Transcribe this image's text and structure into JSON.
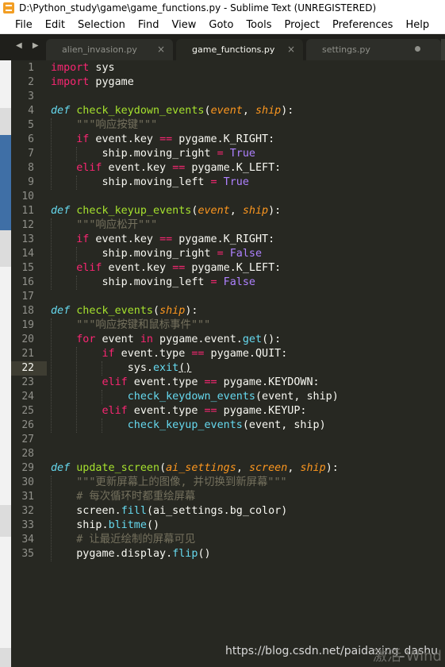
{
  "window": {
    "title": "D:\\Python_study\\game\\game_functions.py - Sublime Text (UNREGISTERED)"
  },
  "menu": [
    "File",
    "Edit",
    "Selection",
    "Find",
    "View",
    "Goto",
    "Tools",
    "Project",
    "Preferences",
    "Help"
  ],
  "tabs": [
    {
      "label": "alien_invasion.py",
      "state": "close"
    },
    {
      "label": "game_functions.py",
      "state": "active"
    },
    {
      "label": "settings.py",
      "state": "modified"
    }
  ],
  "nav_arrows": "◀ ▶",
  "close_glyph": "×",
  "editor": {
    "current_line": 22
  },
  "lines": [
    [
      [
        "k",
        "import"
      ],
      [
        "t",
        " sys"
      ]
    ],
    [
      [
        "k",
        "import"
      ],
      [
        "t",
        " pygame"
      ]
    ],
    [],
    [
      [
        "d",
        "def"
      ],
      [
        "t",
        " "
      ],
      [
        "f",
        "check_keydown_events"
      ],
      [
        "t",
        "("
      ],
      [
        "p",
        "event"
      ],
      [
        "t",
        ", "
      ],
      [
        "p",
        "ship"
      ],
      [
        "t",
        "):"
      ]
    ],
    [
      [
        "t",
        "    "
      ],
      [
        "c",
        "\"\"\"响应按键\"\"\""
      ]
    ],
    [
      [
        "t",
        "    "
      ],
      [
        "k",
        "if"
      ],
      [
        "t",
        " event.key "
      ],
      [
        "k",
        "=="
      ],
      [
        "t",
        " pygame.K_RIGHT:"
      ]
    ],
    [
      [
        "t",
        "        ship.moving_right "
      ],
      [
        "k",
        "="
      ],
      [
        "t",
        " "
      ],
      [
        "n",
        "True"
      ]
    ],
    [
      [
        "t",
        "    "
      ],
      [
        "k",
        "elif"
      ],
      [
        "t",
        " event.key "
      ],
      [
        "k",
        "=="
      ],
      [
        "t",
        " pygame.K_LEFT:"
      ]
    ],
    [
      [
        "t",
        "        ship.moving_left "
      ],
      [
        "k",
        "="
      ],
      [
        "t",
        " "
      ],
      [
        "n",
        "True"
      ]
    ],
    [],
    [
      [
        "d",
        "def"
      ],
      [
        "t",
        " "
      ],
      [
        "f",
        "check_keyup_events"
      ],
      [
        "t",
        "("
      ],
      [
        "p",
        "event"
      ],
      [
        "t",
        ", "
      ],
      [
        "p",
        "ship"
      ],
      [
        "t",
        "):"
      ]
    ],
    [
      [
        "t",
        "    "
      ],
      [
        "c",
        "\"\"\"响应松开\"\"\""
      ]
    ],
    [
      [
        "t",
        "    "
      ],
      [
        "k",
        "if"
      ],
      [
        "t",
        " event.key "
      ],
      [
        "k",
        "=="
      ],
      [
        "t",
        " pygame.K_RIGHT:"
      ]
    ],
    [
      [
        "t",
        "        ship.moving_right "
      ],
      [
        "k",
        "="
      ],
      [
        "t",
        " "
      ],
      [
        "n",
        "False"
      ]
    ],
    [
      [
        "t",
        "    "
      ],
      [
        "k",
        "elif"
      ],
      [
        "t",
        " event.key "
      ],
      [
        "k",
        "=="
      ],
      [
        "t",
        " pygame.K_LEFT:"
      ]
    ],
    [
      [
        "t",
        "        ship.moving_left "
      ],
      [
        "k",
        "="
      ],
      [
        "t",
        " "
      ],
      [
        "n",
        "False"
      ]
    ],
    [],
    [
      [
        "d",
        "def"
      ],
      [
        "t",
        " "
      ],
      [
        "f",
        "check_events"
      ],
      [
        "t",
        "("
      ],
      [
        "p",
        "ship"
      ],
      [
        "t",
        "):"
      ]
    ],
    [
      [
        "t",
        "    "
      ],
      [
        "c",
        "\"\"\"响应按键和鼠标事件\"\"\""
      ]
    ],
    [
      [
        "t",
        "    "
      ],
      [
        "k",
        "for"
      ],
      [
        "t",
        " event "
      ],
      [
        "k",
        "in"
      ],
      [
        "t",
        " pygame.event."
      ],
      [
        "b",
        "get"
      ],
      [
        "t",
        "():"
      ]
    ],
    [
      [
        "t",
        "        "
      ],
      [
        "k",
        "if"
      ],
      [
        "t",
        " event.type "
      ],
      [
        "k",
        "=="
      ],
      [
        "t",
        " pygame.QUIT:"
      ]
    ],
    [
      [
        "t",
        "            sys."
      ],
      [
        "b",
        "exit"
      ],
      [
        "u",
        "()"
      ]
    ],
    [
      [
        "t",
        "        "
      ],
      [
        "k",
        "elif"
      ],
      [
        "t",
        " event.type "
      ],
      [
        "k",
        "=="
      ],
      [
        "t",
        " pygame.KEYDOWN:"
      ]
    ],
    [
      [
        "t",
        "            "
      ],
      [
        "b",
        "check_keydown_events"
      ],
      [
        "t",
        "(event, ship)"
      ]
    ],
    [
      [
        "t",
        "        "
      ],
      [
        "k",
        "elif"
      ],
      [
        "t",
        " event.type "
      ],
      [
        "k",
        "=="
      ],
      [
        "t",
        " pygame.KEYUP:"
      ]
    ],
    [
      [
        "t",
        "            "
      ],
      [
        "b",
        "check_keyup_events"
      ],
      [
        "t",
        "(event, ship)"
      ]
    ],
    [],
    [],
    [
      [
        "d",
        "def"
      ],
      [
        "t",
        " "
      ],
      [
        "f",
        "update_screen"
      ],
      [
        "t",
        "("
      ],
      [
        "p",
        "ai_settings"
      ],
      [
        "t",
        ", "
      ],
      [
        "p",
        "screen"
      ],
      [
        "t",
        ", "
      ],
      [
        "p",
        "ship"
      ],
      [
        "t",
        "):"
      ]
    ],
    [
      [
        "t",
        "    "
      ],
      [
        "c",
        "\"\"\"更新屏幕上的图像, 并切换到新屏幕\"\"\""
      ]
    ],
    [
      [
        "t",
        "    "
      ],
      [
        "c",
        "# 每次循环时都重绘屏幕"
      ]
    ],
    [
      [
        "t",
        "    screen."
      ],
      [
        "b",
        "fill"
      ],
      [
        "t",
        "(ai_settings.bg_color)"
      ]
    ],
    [
      [
        "t",
        "    ship."
      ],
      [
        "b",
        "blitme"
      ],
      [
        "t",
        "()"
      ]
    ],
    [
      [
        "t",
        "    "
      ],
      [
        "c",
        "# 让最近绘制的屏幕可见"
      ]
    ],
    [
      [
        "t",
        "    pygame.display."
      ],
      [
        "b",
        "flip"
      ],
      [
        "t",
        "()"
      ]
    ]
  ],
  "watermark": "https://blog.csdn.net/paidaxing_dashu",
  "watermark_overlay": "激活 Wind"
}
